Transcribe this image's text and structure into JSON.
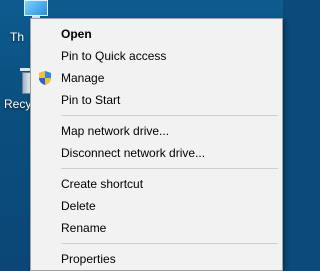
{
  "desktop": {
    "icons": [
      {
        "label": "Th"
      },
      {
        "label": "Recy"
      }
    ]
  },
  "context_menu": {
    "groups": [
      [
        {
          "label": "Open",
          "bold": true
        },
        {
          "label": "Pin to Quick access"
        },
        {
          "label": "Manage",
          "icon": "uac-shield-icon"
        },
        {
          "label": "Pin to Start"
        }
      ],
      [
        {
          "label": "Map network drive..."
        },
        {
          "label": "Disconnect network drive..."
        }
      ],
      [
        {
          "label": "Create shortcut"
        },
        {
          "label": "Delete"
        },
        {
          "label": "Rename"
        }
      ],
      [
        {
          "label": "Properties"
        }
      ]
    ]
  },
  "colors": {
    "menu_background": "#f2f2f2",
    "separator": "#cfcfcf",
    "desktop_blue": "#0a4f7e"
  }
}
